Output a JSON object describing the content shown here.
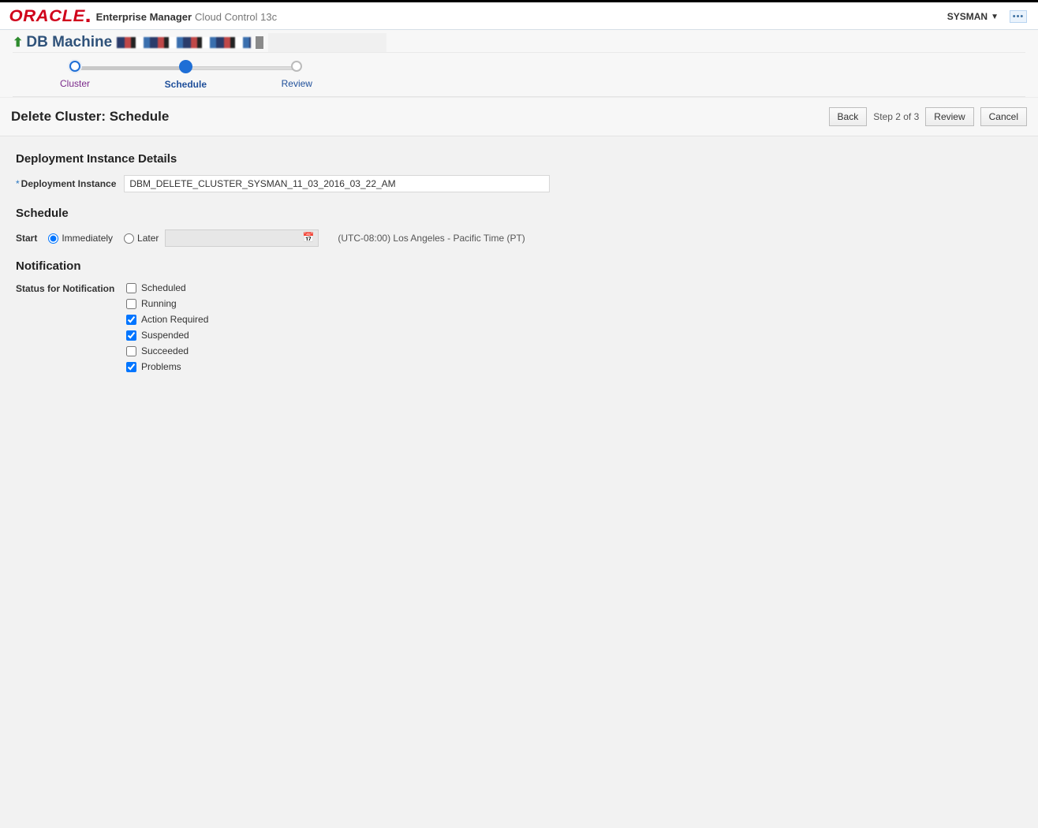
{
  "brand": {
    "logo_text": "ORACLE",
    "em_label": "Enterprise Manager",
    "cc_label": "Cloud Control 13c",
    "user": "SYSMAN"
  },
  "target": {
    "title_prefix": "DB Machine"
  },
  "wizard": {
    "steps": [
      "Cluster",
      "Schedule",
      "Review"
    ]
  },
  "page": {
    "title": "Delete Cluster: Schedule",
    "back_label": "Back",
    "step_text": "Step 2 of 3",
    "review_label": "Review",
    "cancel_label": "Cancel"
  },
  "deployment": {
    "section_title": "Deployment Instance Details",
    "field_label": "Deployment Instance",
    "value": "DBM_DELETE_CLUSTER_SYSMAN_11_03_2016_03_22_AM"
  },
  "schedule": {
    "section_title": "Schedule",
    "start_label": "Start",
    "radio_immediately": "Immediately",
    "radio_later": "Later",
    "timezone_text": "(UTC-08:00) Los Angeles - Pacific Time (PT)"
  },
  "notification": {
    "section_title": "Notification",
    "status_label": "Status for Notification",
    "options": {
      "scheduled": "Scheduled",
      "running": "Running",
      "action_required": "Action Required",
      "suspended": "Suspended",
      "succeeded": "Succeeded",
      "problems": "Problems"
    }
  }
}
